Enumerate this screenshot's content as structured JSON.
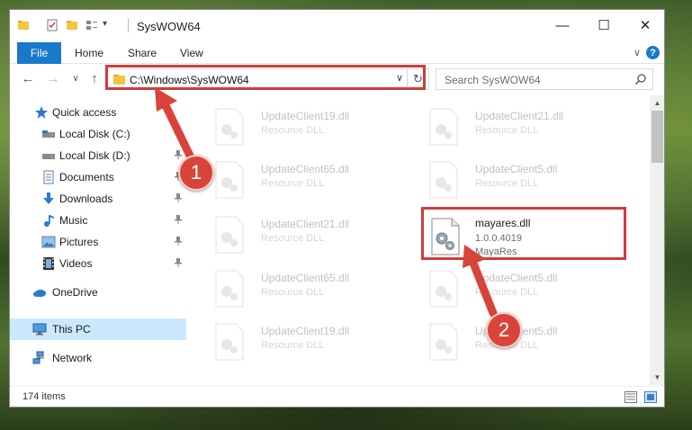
{
  "window": {
    "title": "SysWOW64",
    "minimize_glyph": "—",
    "maximize_glyph": "☐",
    "close_glyph": "✕"
  },
  "ribbon": {
    "tabs": [
      "File",
      "Home",
      "Share",
      "View"
    ],
    "help_glyph": "?",
    "collapse_glyph": "∨"
  },
  "navigation": {
    "back_glyph": "←",
    "forward_glyph": "→",
    "recent_glyph": "∨",
    "up_glyph": "↑",
    "address": "C:\\Windows\\SysWOW64",
    "address_dropdown_glyph": "∨",
    "refresh_glyph": "↻",
    "search_placeholder": "Search SysWOW64"
  },
  "sidebar": {
    "items": [
      {
        "label": "Quick access",
        "icon": "star-icon",
        "pinned": false
      },
      {
        "label": "Local Disk (C:)",
        "icon": "drive-icon",
        "pinned": true
      },
      {
        "label": "Local Disk (D:)",
        "icon": "drive-icon",
        "pinned": true
      },
      {
        "label": "Documents",
        "icon": "documents-icon",
        "pinned": true
      },
      {
        "label": "Downloads",
        "icon": "download-icon",
        "pinned": true
      },
      {
        "label": "Music",
        "icon": "music-icon",
        "pinned": true
      },
      {
        "label": "Pictures",
        "icon": "pictures-icon",
        "pinned": true
      },
      {
        "label": "Videos",
        "icon": "videos-icon",
        "pinned": true
      },
      {
        "label": "OneDrive",
        "icon": "cloud-icon",
        "pinned": false
      },
      {
        "label": "This PC",
        "icon": "computer-icon",
        "pinned": false,
        "selected": true
      },
      {
        "label": "Network",
        "icon": "network-icon",
        "pinned": false
      }
    ]
  },
  "files": [
    {
      "name": "UpdateClient19.dll",
      "line2": "Resource DLL",
      "line3": "",
      "faded": true
    },
    {
      "name": "UpdateClient21.dll",
      "line2": "Resource DLL",
      "line3": "",
      "faded": true
    },
    {
      "name": "UpdateClient65.dll",
      "line2": "Resource DLL",
      "line3": "",
      "faded": true
    },
    {
      "name": "UpdateClient5.dll",
      "line2": "Resource DLL",
      "line3": "",
      "faded": true
    },
    {
      "name": "UpdateClient21.dll",
      "line2": "Resource DLL",
      "line3": "",
      "faded": true
    },
    {
      "name": "mayares.dll",
      "line2": "1.0.0.4019",
      "line3": "MayaRes",
      "faded": false
    },
    {
      "name": "UpdateClient65.dll",
      "line2": "Resource DLL",
      "line3": "",
      "faded": true
    },
    {
      "name": "UpdateClient5.dll",
      "line2": "Resource DLL",
      "line3": "",
      "faded": true
    },
    {
      "name": "UpdateClient19.dll",
      "line2": "Resource DLL",
      "line3": "",
      "faded": true
    },
    {
      "name": "UpdateClient5.dll",
      "line2": "Resource DLL",
      "line3": "",
      "faded": true
    }
  ],
  "status": {
    "item_count": "174 items"
  },
  "annotations": {
    "step1": "1",
    "step2": "2",
    "color": "#d13b3b"
  },
  "colors": {
    "accent": "#1979ca",
    "selection": "#cce8ff",
    "annotation_red": "#d13b3b"
  }
}
